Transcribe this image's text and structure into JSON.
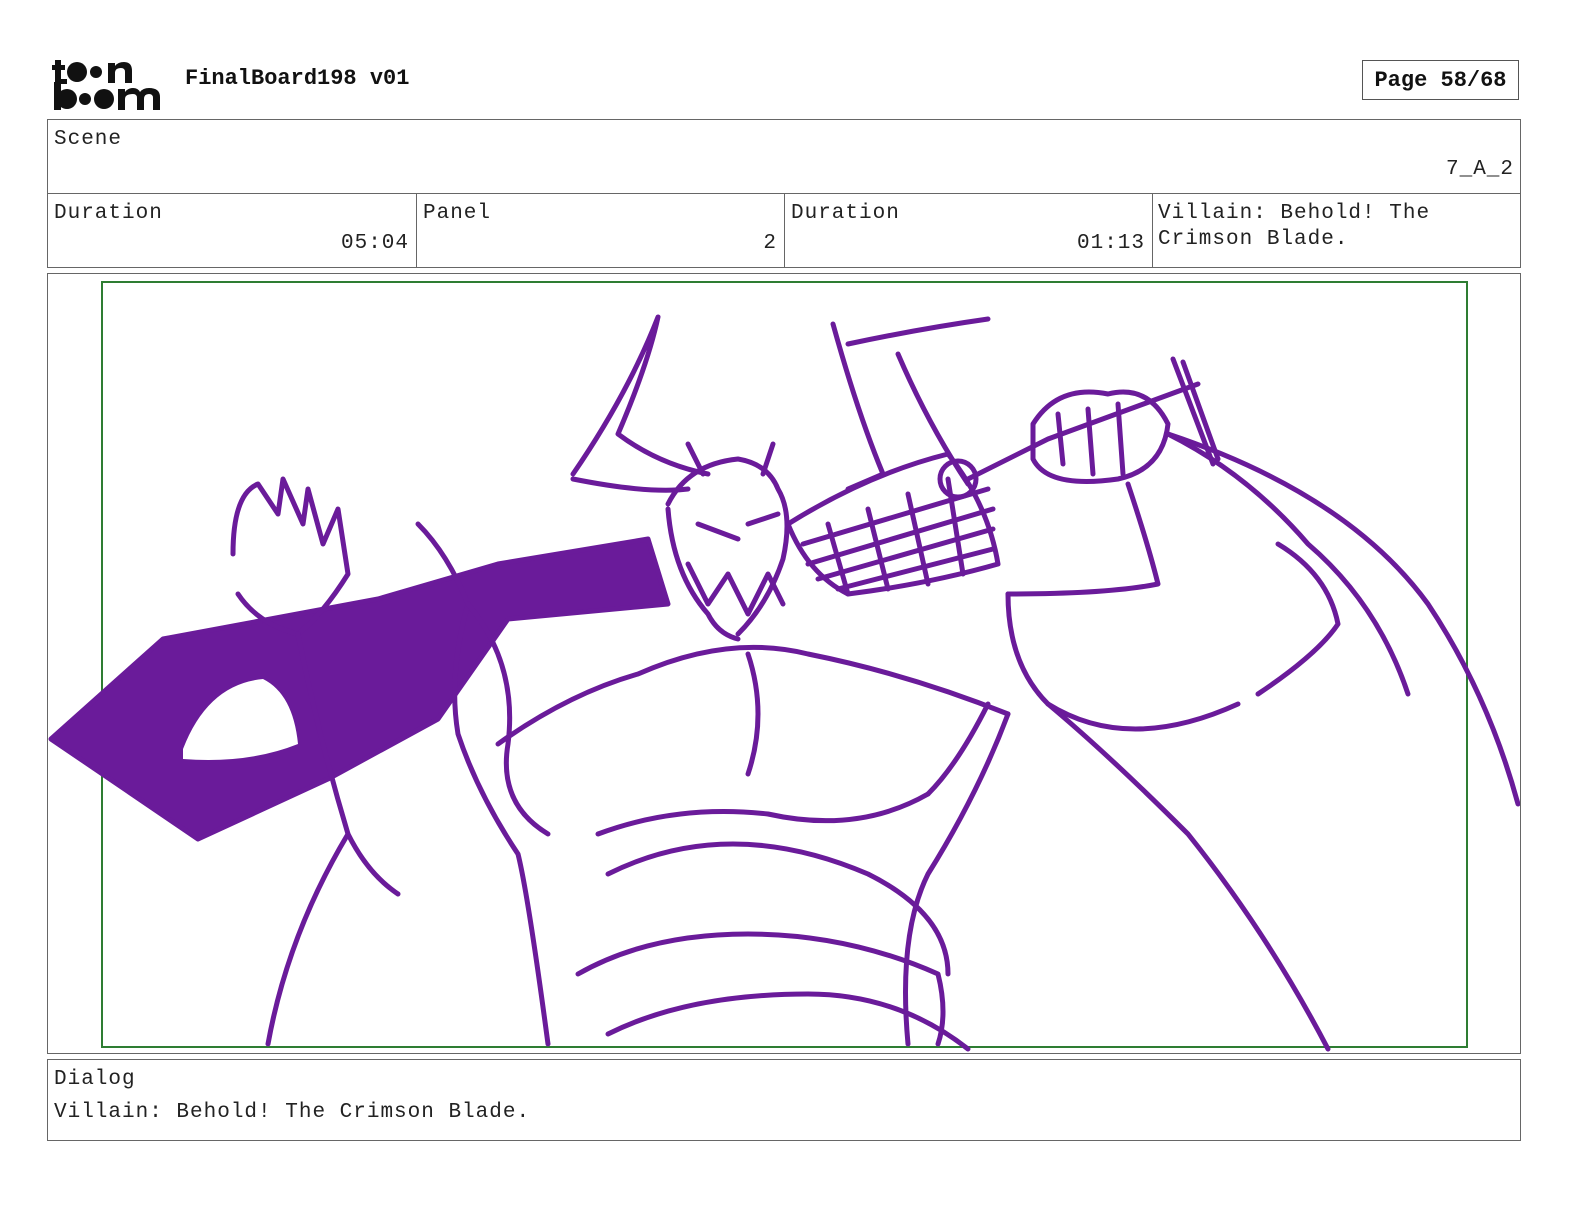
{
  "header": {
    "logo_alt": "toon boom",
    "project_title": "FinalBoard198 v01",
    "page_label": "Page 58/68"
  },
  "scene": {
    "label": "Scene",
    "value": "7_A_2"
  },
  "details": {
    "scene_duration_label": "Duration",
    "scene_duration_value": "05:04",
    "panel_label": "Panel",
    "panel_value": "2",
    "panel_duration_label": "Duration",
    "panel_duration_value": "01:13",
    "note": "Villain: Behold! The Crimson Blade."
  },
  "dialog": {
    "label": "Dialog",
    "text": "Villain: Behold! The Crimson Blade."
  },
  "colors": {
    "sketch": "#6a1b9a",
    "safe_frame": "#2e7d32",
    "border": "#666666"
  }
}
